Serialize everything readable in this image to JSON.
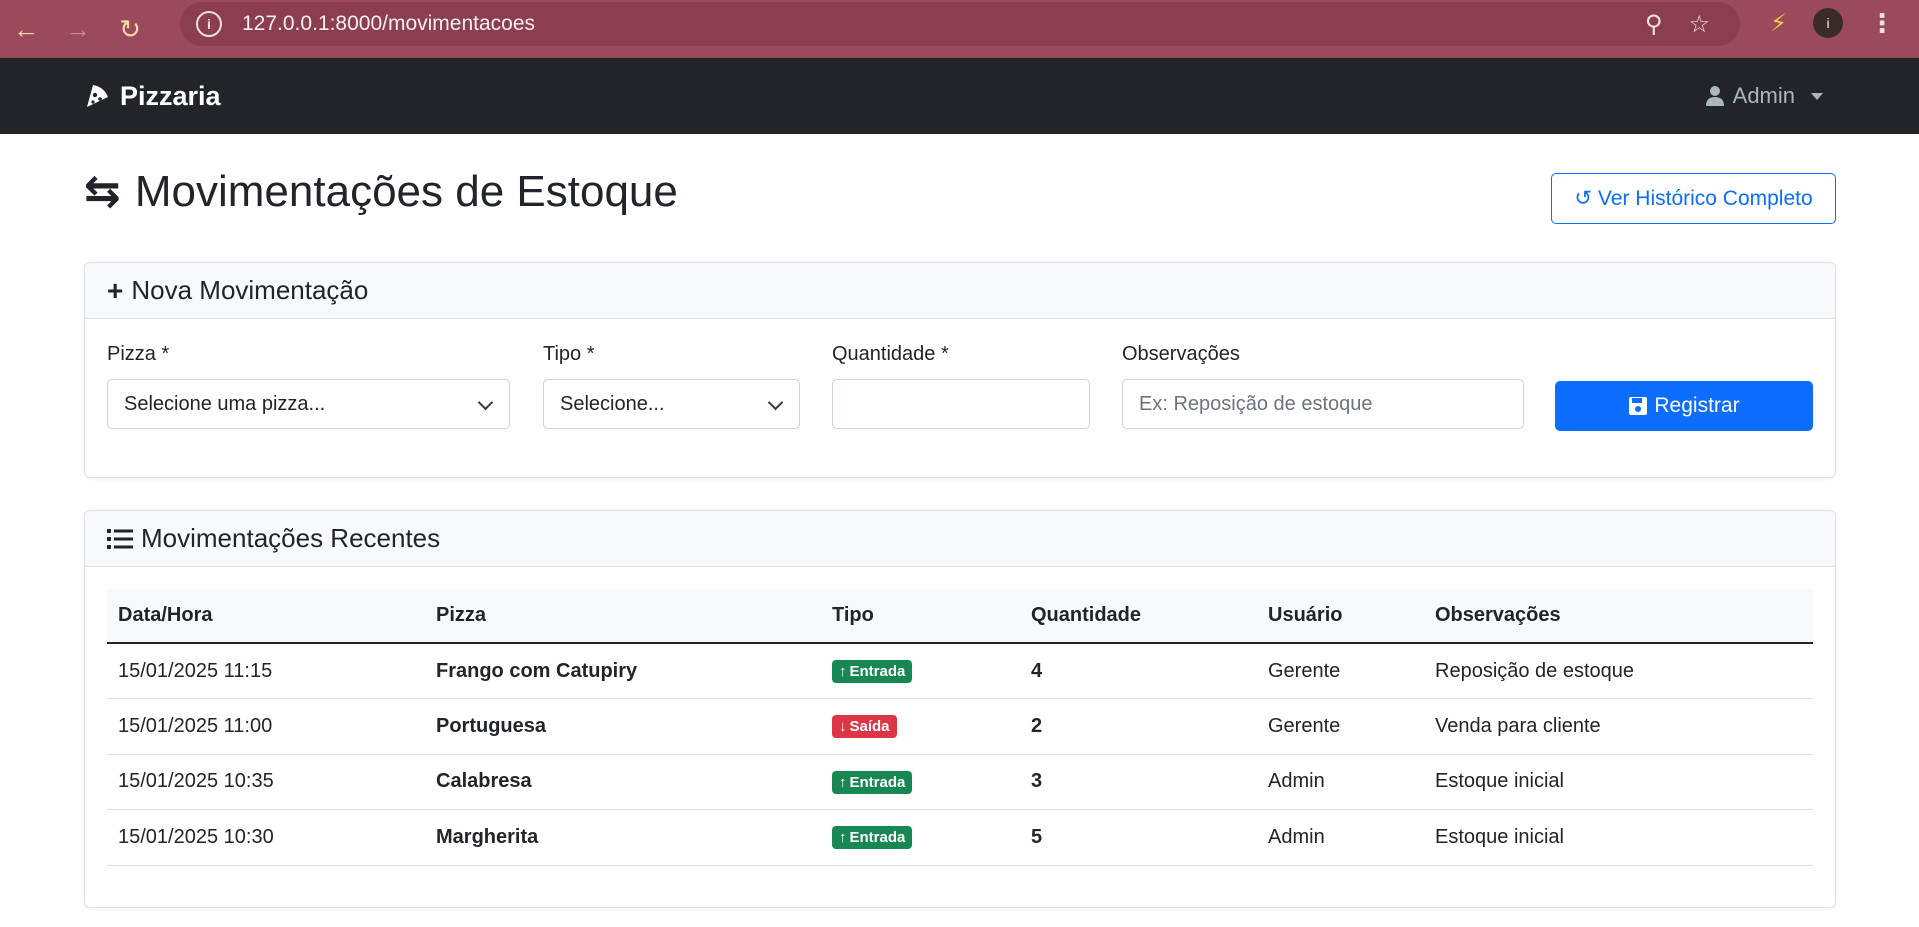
{
  "browser": {
    "url": "127.0.0.1:8000/movimentacoes",
    "profile_initial": "i"
  },
  "navbar": {
    "brand": "Pizzaria",
    "user": "Admin"
  },
  "page": {
    "title": "Movimentações de Estoque",
    "history_button": "Ver Histórico Completo"
  },
  "form": {
    "header": "Nova Movimentação",
    "pizza_label": "Pizza *",
    "pizza_value": "Selecione uma pizza...",
    "tipo_label": "Tipo *",
    "tipo_value": "Selecione...",
    "quantidade_label": "Quantidade *",
    "quantidade_value": "",
    "observacoes_label": "Observações",
    "observacoes_placeholder": "Ex: Reposição de estoque",
    "submit": "Registrar"
  },
  "recent": {
    "header": "Movimentações Recentes",
    "columns": [
      "Data/Hora",
      "Pizza",
      "Tipo",
      "Quantidade",
      "Usuário",
      "Observações"
    ],
    "rows": [
      {
        "datetime": "15/01/2025 11:15",
        "pizza": "Frango com Catupiry",
        "tipo": "Entrada",
        "quantidade": "4",
        "usuario": "Gerente",
        "obs": "Reposição de estoque"
      },
      {
        "datetime": "15/01/2025 11:00",
        "pizza": "Portuguesa",
        "tipo": "Saída",
        "quantidade": "2",
        "usuario": "Gerente",
        "obs": "Venda para cliente"
      },
      {
        "datetime": "15/01/2025 10:35",
        "pizza": "Calabresa",
        "tipo": "Entrada",
        "quantidade": "3",
        "usuario": "Admin",
        "obs": "Estoque inicial"
      },
      {
        "datetime": "15/01/2025 10:30",
        "pizza": "Margherita",
        "tipo": "Entrada",
        "quantidade": "5",
        "usuario": "Admin",
        "obs": "Estoque inicial"
      }
    ]
  },
  "colors": {
    "primary": "#0d6efd",
    "success": "#198754",
    "danger": "#dc3545",
    "navbar": "#212529",
    "browser_frame": "#9b4a5b"
  }
}
